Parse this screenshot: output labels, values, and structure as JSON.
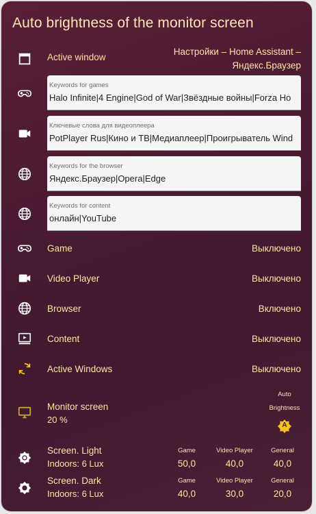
{
  "title": "Auto brightness of the monitor screen",
  "active_window": {
    "label": "Active window",
    "value_line1": "Настройки – Home Assistant –",
    "value_line2": "Яндекс.Браузер"
  },
  "fields": [
    {
      "label": "Keywords for games",
      "value": "Halo Infinite|4 Engine|God of War|Звёздные войны|Forza Ho"
    },
    {
      "label": "Ключевые слова для видеоплеера",
      "value": "PotPlayer Rus|Кино и ТВ|Медиаплеер|Проигрыватель Wind"
    },
    {
      "label": "Keywords for the browser",
      "value": "Яндекс.Браузер|Opera|Edge"
    },
    {
      "label": "Keywords for content",
      "value": "онлайн|YouTube"
    }
  ],
  "states": [
    {
      "label": "Game",
      "value": "Выключено"
    },
    {
      "label": "Video Player",
      "value": "Выключено"
    },
    {
      "label": "Browser",
      "value": "Включено"
    },
    {
      "label": "Content",
      "value": "Выключено"
    },
    {
      "label": "Active Windows",
      "value": "Выключено"
    }
  ],
  "monitor": {
    "label": "Monitor screen",
    "percent": "20 %",
    "auto_line1": "Auto",
    "auto_line2": "Brightness",
    "badge": "A"
  },
  "screen_light": {
    "label": "Screen. Light",
    "sub": "Indoors: 6 Lux",
    "cols": [
      {
        "h": "Game",
        "v": "50,0"
      },
      {
        "h": "Video Player",
        "v": "40,0"
      },
      {
        "h": "General",
        "v": "40,0"
      }
    ]
  },
  "screen_dark": {
    "label": "Screen. Dark",
    "sub": "Indoors: 6 Lux",
    "cols": [
      {
        "h": "Game",
        "v": "40,0"
      },
      {
        "h": "Video Player",
        "v": "30,0"
      },
      {
        "h": "General",
        "v": "20,0"
      }
    ]
  },
  "colors": {
    "text": "#ffe2a8",
    "icon": "#ffffff",
    "accent": "#f4c21b"
  }
}
